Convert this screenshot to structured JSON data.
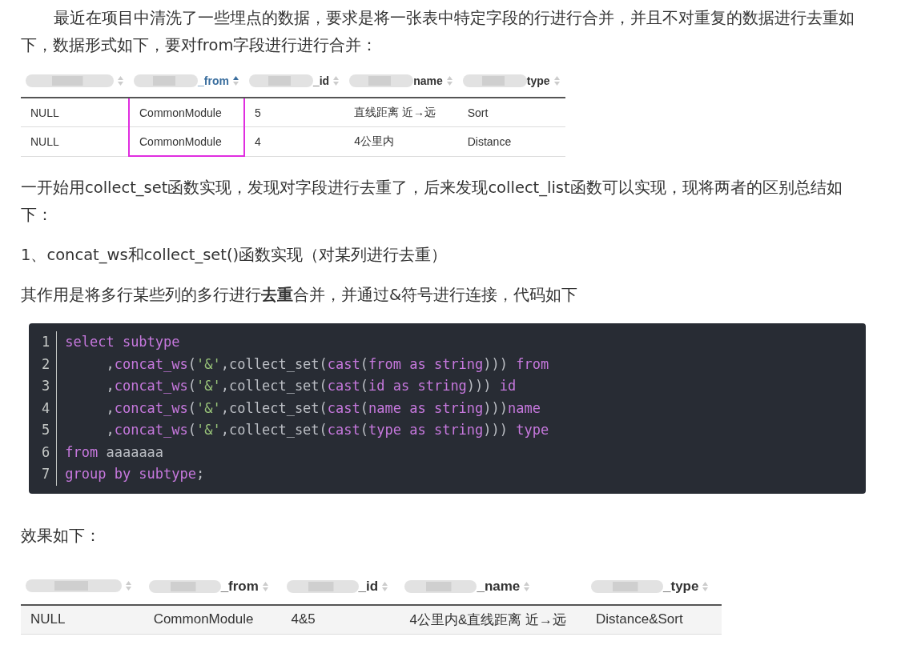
{
  "paragraphs_top": [
    {
      "text": "最近在项目中清洗了一些埋点的数据，要求是将一张表中特定字段的行进行合并，并且不对重复的数据进行去重如下，数据形式如下，要对from字段进行进行合并："
    }
  ],
  "table_1": {
    "columns": [
      {
        "active": false,
        "highlighted": false
      },
      {
        "label": "_from",
        "active": true,
        "highlighted": true
      },
      {
        "label": "_id",
        "active": false,
        "highlighted": false
      },
      {
        "label": "name",
        "active": false,
        "highlighted": false
      },
      {
        "label": "type",
        "active": false,
        "highlighted": false
      }
    ],
    "rows": [
      [
        "NULL",
        "CommonModule",
        "5",
        "直线距离 近→远",
        "Sort"
      ],
      [
        "NULL",
        "CommonModule",
        "4",
        "4公里内",
        "Distance"
      ]
    ]
  },
  "paragraphs_middle": [
    {
      "text": "一开始用collect_set函数实现，发现对字段进行去重了，后来发现collect_list函数可以实现，现将两者的区别总结如下："
    },
    {
      "text": "1、concat_ws和collect_set()函数实现（对某列进行去重）"
    },
    {
      "text": "其作用是将多行某些列的多行进行**去重**合并，并通过&符号进行连接，代码如下"
    }
  ],
  "code": {
    "lines": [
      {
        "number": "1",
        "tokens": [
          {
            "kind": "kw",
            "text": "select subtype"
          }
        ]
      },
      {
        "number": "2",
        "tokens": [
          {
            "kind": "plain",
            "text": "     ,"
          },
          {
            "kind": "kw",
            "text": "concat_ws"
          },
          {
            "kind": "plain",
            "text": "("
          },
          {
            "kind": "str",
            "text": "'&'"
          },
          {
            "kind": "plain",
            "text": ",collect_set("
          },
          {
            "kind": "kw",
            "text": "cast"
          },
          {
            "kind": "plain",
            "text": "("
          },
          {
            "kind": "kw",
            "text": "from as string"
          },
          {
            "kind": "plain",
            "text": "))) "
          },
          {
            "kind": "kw",
            "text": "from"
          }
        ]
      },
      {
        "number": "3",
        "tokens": [
          {
            "kind": "plain",
            "text": "     ,"
          },
          {
            "kind": "kw",
            "text": "concat_ws"
          },
          {
            "kind": "plain",
            "text": "("
          },
          {
            "kind": "str",
            "text": "'&'"
          },
          {
            "kind": "plain",
            "text": ",collect_set("
          },
          {
            "kind": "kw",
            "text": "cast"
          },
          {
            "kind": "plain",
            "text": "("
          },
          {
            "kind": "kw",
            "text": "id as string"
          },
          {
            "kind": "plain",
            "text": "))) "
          },
          {
            "kind": "kw",
            "text": "id"
          }
        ]
      },
      {
        "number": "4",
        "tokens": [
          {
            "kind": "plain",
            "text": "     ,"
          },
          {
            "kind": "kw",
            "text": "concat_ws"
          },
          {
            "kind": "plain",
            "text": "("
          },
          {
            "kind": "str",
            "text": "'&'"
          },
          {
            "kind": "plain",
            "text": ",collect_set("
          },
          {
            "kind": "kw",
            "text": "cast"
          },
          {
            "kind": "plain",
            "text": "("
          },
          {
            "kind": "kw",
            "text": "name as string"
          },
          {
            "kind": "plain",
            "text": ")))"
          },
          {
            "kind": "kw",
            "text": "name"
          }
        ]
      },
      {
        "number": "5",
        "tokens": [
          {
            "kind": "plain",
            "text": "     ,"
          },
          {
            "kind": "kw",
            "text": "concat_ws"
          },
          {
            "kind": "plain",
            "text": "("
          },
          {
            "kind": "str",
            "text": "'&'"
          },
          {
            "kind": "plain",
            "text": ",collect_set("
          },
          {
            "kind": "kw",
            "text": "cast"
          },
          {
            "kind": "plain",
            "text": "("
          },
          {
            "kind": "kw",
            "text": "type as string"
          },
          {
            "kind": "plain",
            "text": "))) "
          },
          {
            "kind": "kw",
            "text": "type"
          }
        ]
      },
      {
        "number": "6",
        "tokens": [
          {
            "kind": "kw",
            "text": "from"
          },
          {
            "kind": "plain",
            "text": " aaaaaaa"
          }
        ]
      },
      {
        "number": "7",
        "tokens": [
          {
            "kind": "kw",
            "text": "group by subtype"
          },
          {
            "kind": "plain",
            "text": ";"
          }
        ]
      }
    ]
  },
  "paragraphs_bottom": [
    {
      "text": "效果如下："
    }
  ],
  "table_2": {
    "columns": [
      {
        "active": false,
        "highlighted": false
      },
      {
        "label": "_from",
        "active": false,
        "highlighted": false
      },
      {
        "label": "_id",
        "active": false,
        "highlighted": false
      },
      {
        "label": "_name",
        "active": false,
        "highlighted": false
      },
      {
        "label": "_type",
        "active": false,
        "highlighted": false
      }
    ],
    "rows": [
      [
        "NULL",
        "CommonModule",
        "4&5",
        "4公里内&直线距离 近→远",
        "Distance&Sort"
      ]
    ]
  }
}
